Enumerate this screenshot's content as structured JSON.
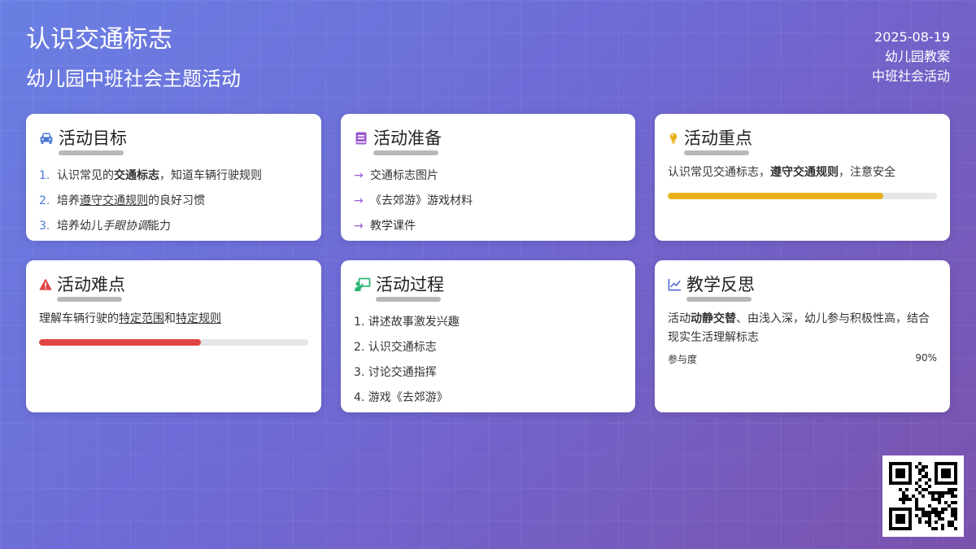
{
  "header": {
    "title": "认识交通标志",
    "subtitle": "幼儿园中班社会主题活动",
    "date": "2025-08-19",
    "doc_type": "幼儿园教案",
    "category": "中班社会活动"
  },
  "colors": {
    "accent_blue": "#4a77d4",
    "accent_purple": "#9b59d0",
    "accent_yellow": "#e8b21a",
    "accent_red": "#e04444",
    "accent_green": "#2bb673",
    "accent_indigo": "#5a6fd6"
  },
  "cards": {
    "goals": {
      "icon": "car-icon",
      "title": "活动目标",
      "items": [
        {
          "num": "1.",
          "pre": "认识常见的",
          "em": "交通标志",
          "post": "，知道车辆行驶规则"
        },
        {
          "num": "2.",
          "pre": "培养",
          "em": "遵守交通规则",
          "post": "的良好习惯"
        },
        {
          "num": "3.",
          "pre": "培养幼儿",
          "em": "手眼协调",
          "post": "能力"
        }
      ]
    },
    "prep": {
      "icon": "book-icon",
      "title": "活动准备",
      "arrow": "→",
      "items": [
        "交通标志图片",
        "《去郊游》游戏材料",
        "教学课件"
      ]
    },
    "focus": {
      "icon": "lightbulb-icon",
      "title": "活动重点",
      "pre": "认识常见交通标志，",
      "em": "遵守交通规则",
      "post": "，注意安全",
      "progress": 0.8
    },
    "difficulty": {
      "icon": "warning-icon",
      "title": "活动难点",
      "pre": "理解车辆行驶的",
      "u1": "特定范围",
      "mid": "和",
      "u2": "特定规则",
      "progress": 0.6
    },
    "process": {
      "icon": "teacher-board-icon",
      "title": "活动过程",
      "items": [
        "1. 讲述故事激发兴趣",
        "2. 认识交通标志",
        "3. 讨论交通指挥",
        "4. 游戏《去郊游》"
      ]
    },
    "reflection": {
      "icon": "line-chart-icon",
      "title": "教学反思",
      "pre": "活动",
      "em": "动静交替",
      "post": "、由浅入深，幼儿参与积极性高，结合现实生活理解标志",
      "meter_label": "参与度",
      "meter_value": "90%"
    }
  }
}
